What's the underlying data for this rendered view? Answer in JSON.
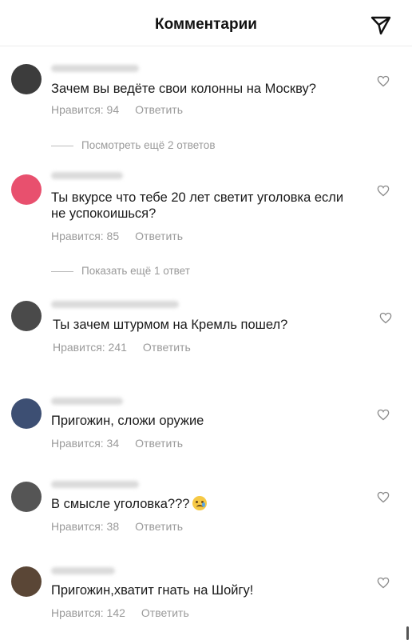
{
  "header": {
    "title": "Комментарии",
    "send_icon": "paper-plane-icon"
  },
  "comments": [
    {
      "text": "Зачем вы ведёте свои колонны на Москву?",
      "likes": "Нравится: 94",
      "reply": "Ответить",
      "avatar_color": "#3c3c3c"
    },
    {
      "text": "Ты вкурсе что тебе 20 лет светит уголовка если не успокоишься?",
      "likes": "Нравится: 85",
      "reply": "Ответить",
      "avatar_color": "#e8506e"
    },
    {
      "text": "Ты зачем штурмом на Кремль пошел?",
      "likes": "Нравится: 241",
      "reply": "Ответить",
      "avatar_color": "#4a4a4a"
    },
    {
      "text": "Пригожин, сложи оружие",
      "likes": "Нравится: 34",
      "reply": "Ответить",
      "avatar_color": "#3d4f73"
    },
    {
      "text": "В смысле уголовка???",
      "likes": "Нравится: 38",
      "reply": "Ответить",
      "avatar_color": "#555555"
    },
    {
      "text": "Пригожин,хватит гнать на Шойгу!",
      "likes": "Нравится: 142",
      "reply": "Ответить",
      "avatar_color": "#5a4636"
    }
  ],
  "more_replies": [
    {
      "label": "Посмотреть ещё 2 ответов"
    },
    {
      "label": "Показать ещё 1 ответ"
    }
  ],
  "icons": {
    "like": "heart-icon",
    "emoji": "crying-face-emoji"
  }
}
